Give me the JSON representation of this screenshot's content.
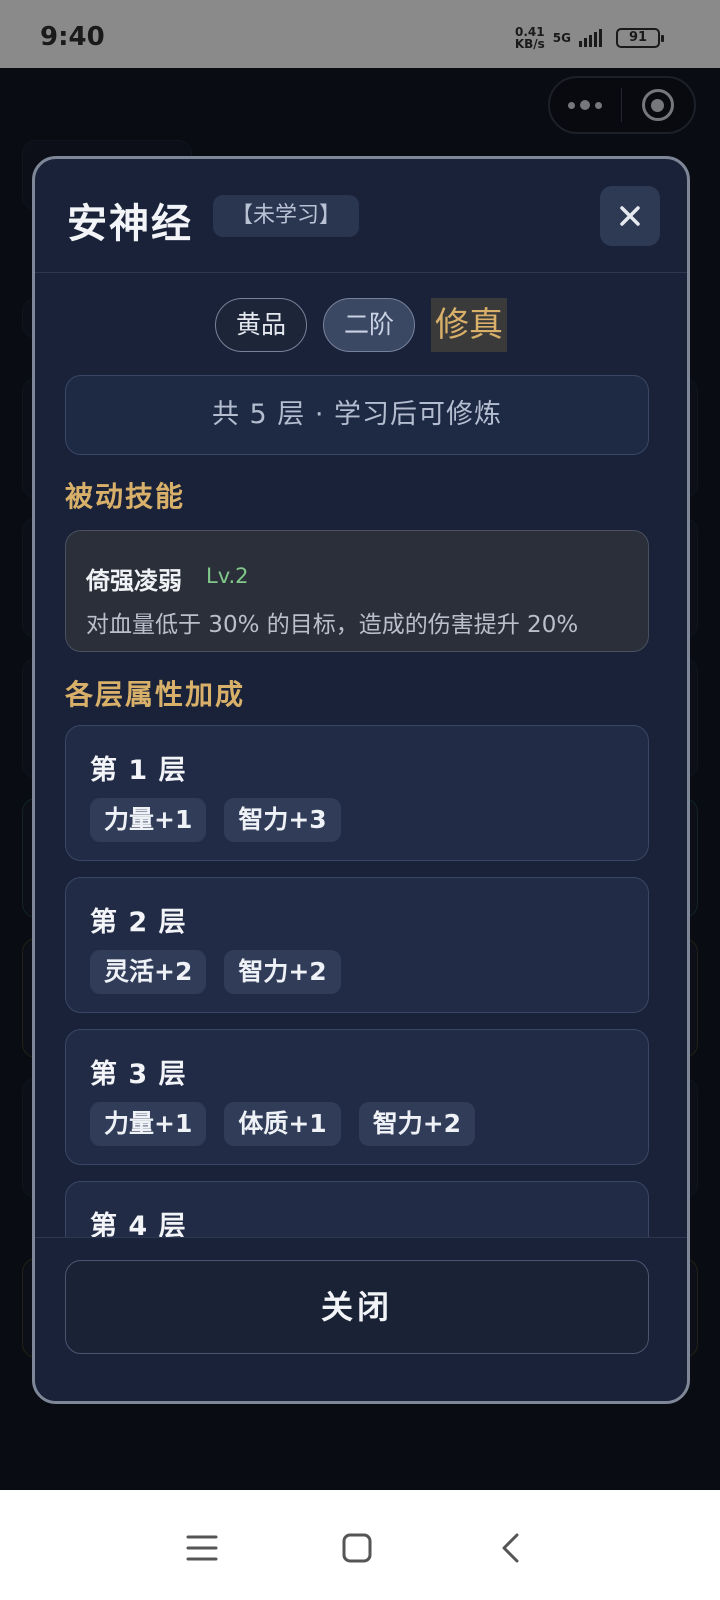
{
  "status_bar": {
    "time": "9:40",
    "net_speed_value": "0.41",
    "net_speed_unit": "KB/s",
    "network": "5G",
    "battery": "91"
  },
  "modal": {
    "title": "安神经",
    "learn_status": "【未学习】",
    "grade": "黄品",
    "tier": "二阶",
    "realm": "修真",
    "layers_summary": "共 5 层 · 学习后可修炼",
    "passive_section_title": "被动技能",
    "passive_skill": {
      "name": "倚强凌弱",
      "level": "Lv.2",
      "description": "对血量低于 30% 的目标，造成的伤害提升 20%"
    },
    "layers_section_title": "各层属性加成",
    "layers": [
      {
        "name": "第 1 层",
        "attributes": [
          "力量+1",
          "智力+3"
        ]
      },
      {
        "name": "第 2 层",
        "attributes": [
          "灵活+2",
          "智力+2"
        ]
      },
      {
        "name": "第 3 层",
        "attributes": [
          "力量+1",
          "体质+1",
          "智力+2"
        ]
      },
      {
        "name": "第 4 层",
        "attributes": []
      }
    ],
    "close_button_label": "关闭"
  },
  "colors": {
    "accent_gold": "#d8b06a",
    "skill_level_green": "#82c88a",
    "modal_bg": "#192238"
  },
  "icons": {
    "close": "close-icon",
    "capsule_more": "more-dots-icon",
    "capsule_close": "target-circle-icon",
    "nav_menu": "menu-icon",
    "nav_home": "home-square-icon",
    "nav_back": "back-chevron-icon"
  }
}
